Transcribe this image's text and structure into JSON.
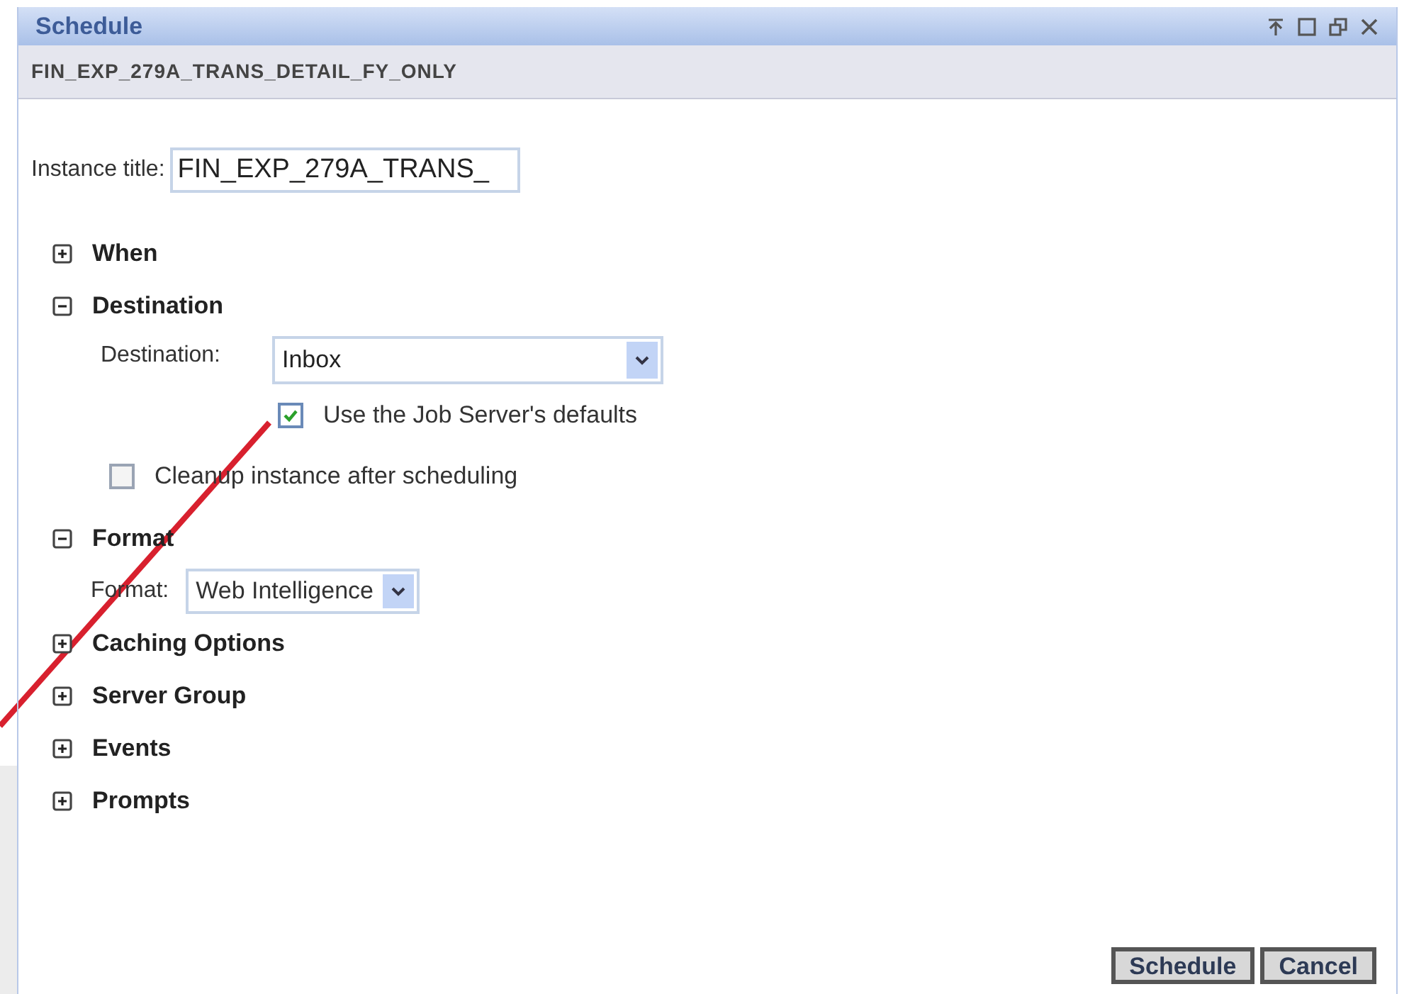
{
  "window": {
    "title": "Schedule"
  },
  "subtitle": "FIN_EXP_279A_TRANS_DETAIL_FY_ONLY",
  "instance_title": {
    "label": "Instance title:",
    "value": "FIN_EXP_279A_TRANS_"
  },
  "sections": [
    {
      "label": "When",
      "expanded": false
    },
    {
      "label": "Destination",
      "expanded": true,
      "fields": [
        {
          "kind": "select",
          "label": "Destination:",
          "value": "Inbox"
        },
        {
          "kind": "option",
          "label": "Use the Job Server's defaults",
          "checked": true
        },
        {
          "kind": "checkbox",
          "label": "Cleanup instance after scheduling",
          "checked": false
        }
      ]
    },
    {
      "label": "Format",
      "expanded": true,
      "fields": [
        {
          "kind": "compact_select",
          "label": "Format:",
          "value": "Web Intelligence"
        }
      ]
    },
    {
      "label": "Caching Options",
      "expanded": false
    },
    {
      "label": "Server Group",
      "expanded": false
    },
    {
      "label": "Events",
      "expanded": false
    },
    {
      "label": "Prompts",
      "expanded": false
    }
  ],
  "buttons": [
    "Schedule",
    "Cancel"
  ]
}
